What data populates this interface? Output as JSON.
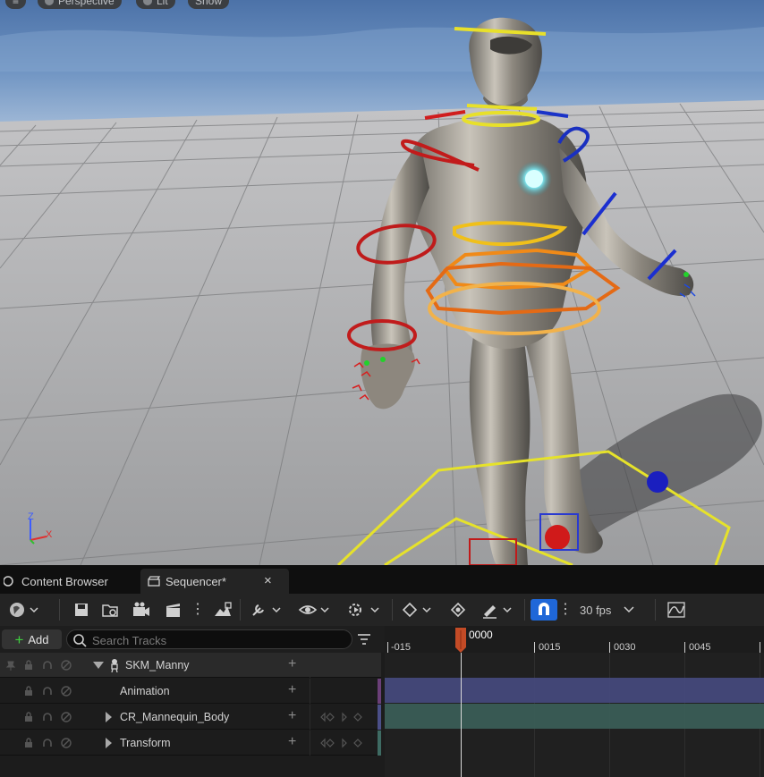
{
  "viewport": {
    "pills": [
      "Perspective",
      "Lit",
      "Show"
    ],
    "axis": {
      "z": "Z",
      "x": "X"
    }
  },
  "tabs": [
    {
      "label": "Content Browser",
      "active": false
    },
    {
      "label": "Sequencer*",
      "active": true
    }
  ],
  "toolbar": {
    "fps_label": "30 fps"
  },
  "tracks": {
    "add_label": "Add",
    "search_placeholder": "Search Tracks",
    "rows": [
      {
        "label": "SKM_Manny",
        "kind": "skeletal-mesh"
      },
      {
        "label": "Animation",
        "kind": "track"
      },
      {
        "label": "CR_Mannequin_Body",
        "kind": "control-rig"
      },
      {
        "label": "Transform",
        "kind": "transform"
      }
    ]
  },
  "timeline": {
    "current_frame": "0000",
    "ticks": [
      "-015",
      "0015",
      "0030",
      "0045"
    ]
  },
  "colors": {
    "control_rig_bar": "#454a7e",
    "transform_bar": "#3b5e58",
    "playhead": "#c34b26",
    "snap_button": "#1f67d8"
  }
}
